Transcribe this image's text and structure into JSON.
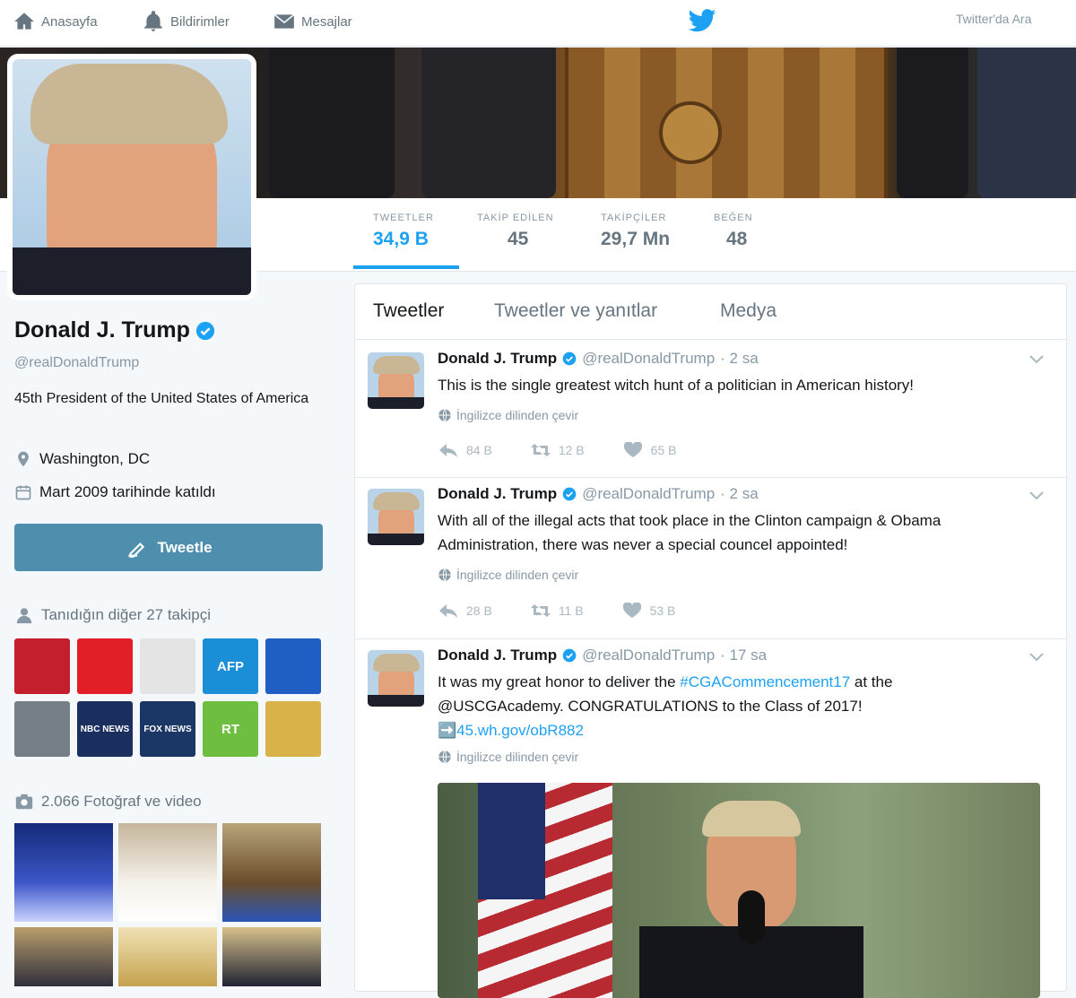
{
  "topbar": {
    "home_label": "Anasayfa",
    "notifications_label": "Bildirimler",
    "messages_label": "Mesajlar",
    "search_label": "Twitter'da Ara"
  },
  "stats": [
    {
      "label": "TWEETLER",
      "value": "34,9 B"
    },
    {
      "label": "TAKİP EDİLEN",
      "value": "45"
    },
    {
      "label": "TAKİPÇİLER",
      "value": "29,7 Mn"
    },
    {
      "label": "BEĞEN",
      "value": "48"
    }
  ],
  "profile": {
    "name": "Donald J. Trump",
    "handle": "@realDonaldTrump",
    "bio": "45th President of the United States of America",
    "location": "Washington, DC",
    "joined": "Mart 2009 tarihinde katıldı",
    "tweet_button": "Tweetle",
    "followers_you_know": "Tanıdığın diğer 27 takipçi",
    "media_count": "2.066 Fotoğraf ve video"
  },
  "follower_tiles": [
    {
      "label": "",
      "color": "#c41f2d"
    },
    {
      "label": "",
      "color": "#e21f26"
    },
    {
      "label": "",
      "color": "#e4e4e4"
    },
    {
      "label": "AFP",
      "color": "#1a8fd8"
    },
    {
      "label": "",
      "color": "#1f5fc4"
    },
    {
      "label": "",
      "color": "#777f86"
    },
    {
      "label": "NBC NEWS",
      "color": "#1b2f5e"
    },
    {
      "label": "FOX NEWS",
      "color": "#1a3766"
    },
    {
      "label": "RT",
      "color": "#6ebf3f"
    },
    {
      "label": "",
      "color": "#d9b24a"
    }
  ],
  "timeline": {
    "tabs": [
      "Tweetler",
      "Tweetler ve yanıtlar",
      "Medya"
    ],
    "tweets": [
      {
        "name": "Donald J. Trump",
        "user": "@realDonaldTrump",
        "time": "· 2 sa",
        "text": "This is the single greatest witch hunt of a politician in American history!",
        "translate": "İngilizce dilinden çevir",
        "replies": "84 B",
        "retweets": "12 B",
        "likes": "65 B"
      },
      {
        "name": "Donald J. Trump",
        "user": "@realDonaldTrump",
        "time": "· 2 sa",
        "text": "With all of the illegal acts that took place in the Clinton campaign & Obama Administration, there was never a special councel appointed!",
        "translate": "İngilizce dilinden çevir",
        "replies": "28 B",
        "retweets": "11 B",
        "likes": "53 B"
      },
      {
        "name": "Donald J. Trump",
        "user": "@realDonaldTrump",
        "time": "· 17 sa",
        "text_1": "It was my great honor to deliver the ",
        "hashtag": "#CGACommencement17",
        "text_2": " at the @USCGAcademy. CONGRATULATIONS to the Class of 2017!",
        "link": "➡️45.wh.gov/obR882",
        "translate": "İngilizce dilinden çevir"
      }
    ]
  },
  "colors": {
    "accent": "#1da1f2",
    "tweet_button": "#4f8fae",
    "verified": "#1da1f2"
  }
}
